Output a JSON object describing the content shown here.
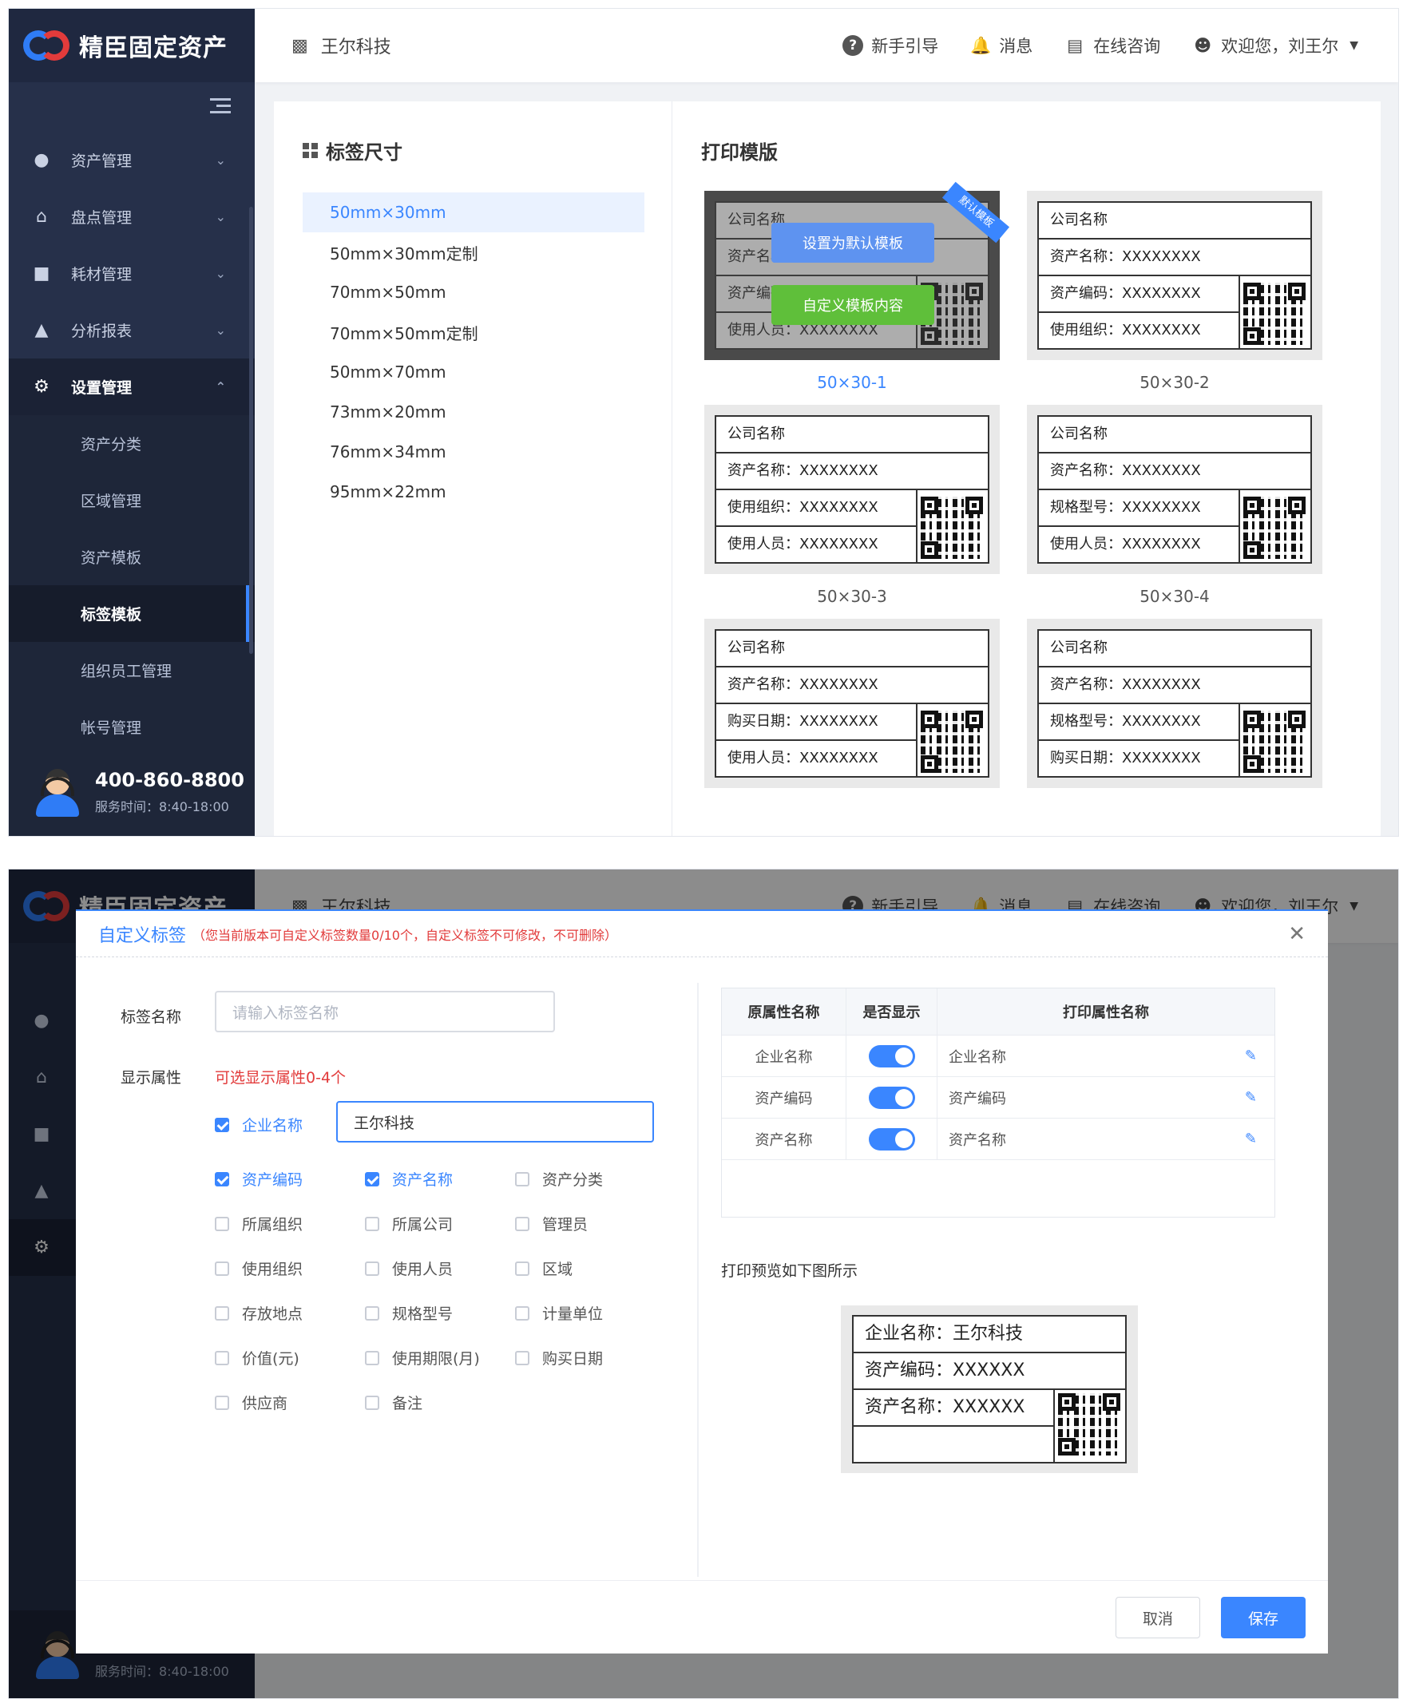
{
  "app": {
    "logo_text": "精臣固定资产",
    "company": "王尔科技",
    "header": {
      "guide": "新手引导",
      "messages": "消息",
      "consult": "在线咨询",
      "welcome": "欢迎您，刘王尔"
    },
    "menu": [
      {
        "label": "资产管理",
        "icon": "money-bag-icon"
      },
      {
        "label": "盘点管理",
        "icon": "warehouse-icon"
      },
      {
        "label": "耗材管理",
        "icon": "box-icon"
      },
      {
        "label": "分析报表",
        "icon": "chart-icon"
      },
      {
        "label": "设置管理",
        "icon": "gear-icon"
      }
    ],
    "submenu": [
      "资产分类",
      "区域管理",
      "资产模板",
      "标签模板",
      "组织员工管理",
      "帐号管理"
    ],
    "hotline": {
      "phone": "400-860-8800",
      "service": "服务时间：8:40-18:00"
    }
  },
  "screen1": {
    "size_title": "标签尺寸",
    "sizes": [
      "50mm×30mm",
      "50mm×30mm定制",
      "70mm×50mm",
      "70mm×50mm定制",
      "50mm×70mm",
      "73mm×20mm",
      "76mm×34mm",
      "95mm×22mm"
    ],
    "print_title": "打印模版",
    "templates": [
      {
        "name": "50×30-1",
        "rows": [
          "公司名称",
          "资产名称：XXXXXXXX",
          "资产编码：XXXXXXXX",
          "使用人员：XXXXXXXX"
        ],
        "ribbon": "默认模板",
        "btn_default": "设置为默认模板",
        "btn_custom": "自定义模板内容"
      },
      {
        "name": "50×30-2",
        "rows": [
          "公司名称",
          "资产名称：XXXXXXXX",
          "资产编码：XXXXXXXX",
          "使用组织：XXXXXXXX"
        ]
      },
      {
        "name": "50×30-3",
        "rows": [
          "公司名称",
          "资产名称：XXXXXXXX",
          "使用组织：XXXXXXXX",
          "使用人员：XXXXXXXX"
        ]
      },
      {
        "name": "50×30-4",
        "rows": [
          "公司名称",
          "资产名称：XXXXXXXX",
          "规格型号：XXXXXXXX",
          "使用人员：XXXXXXXX"
        ]
      },
      {
        "name": "",
        "rows": [
          "公司名称",
          "资产名称：XXXXXXXX",
          "购买日期：XXXXXXXX",
          "使用人员：XXXXXXXX"
        ]
      },
      {
        "name": "",
        "rows": [
          "公司名称",
          "资产名称：XXXXXXXX",
          "规格型号：XXXXXXXX",
          "购买日期：XXXXXXXX"
        ]
      }
    ]
  },
  "modal": {
    "title": "自定义标签",
    "note": "（您当前版本可自定义标签数量0/10个，自定义标签不可修改，不可删除）",
    "name_label": "标签名称",
    "name_placeholder": "请输入标签名称",
    "attr_label": "显示属性",
    "attr_tip": "可选显示属性0-4个",
    "company_check": "企业名称",
    "company_value": "王尔科技",
    "checkboxes": [
      {
        "label": "资产编码",
        "checked": true
      },
      {
        "label": "资产名称",
        "checked": true
      },
      {
        "label": "资产分类",
        "checked": false
      },
      {
        "label": "所属组织",
        "checked": false
      },
      {
        "label": "所属公司",
        "checked": false
      },
      {
        "label": "管理员",
        "checked": false
      },
      {
        "label": "使用组织",
        "checked": false
      },
      {
        "label": "使用人员",
        "checked": false
      },
      {
        "label": "区域",
        "checked": false
      },
      {
        "label": "存放地点",
        "checked": false
      },
      {
        "label": "规格型号",
        "checked": false
      },
      {
        "label": "计量单位",
        "checked": false
      },
      {
        "label": "价值(元)",
        "checked": false
      },
      {
        "label": "使用期限(月)",
        "checked": false
      },
      {
        "label": "购买日期",
        "checked": false
      },
      {
        "label": "供应商",
        "checked": false
      },
      {
        "label": "备注",
        "checked": false
      }
    ],
    "table": {
      "headers": [
        "原属性名称",
        "是否显示",
        "打印属性名称"
      ],
      "rows": [
        {
          "orig": "企业名称",
          "print": "企业名称",
          "on": true
        },
        {
          "orig": "资产编码",
          "print": "资产编码",
          "on": true
        },
        {
          "orig": "资产名称",
          "print": "资产名称",
          "on": true
        }
      ]
    },
    "preview_tip": "打印预览如下图所示",
    "preview_rows": [
      "企业名称：王尔科技",
      "资产编码：XXXXXX",
      "资产名称：XXXXXX",
      ""
    ],
    "cancel": "取消",
    "save": "保存"
  }
}
